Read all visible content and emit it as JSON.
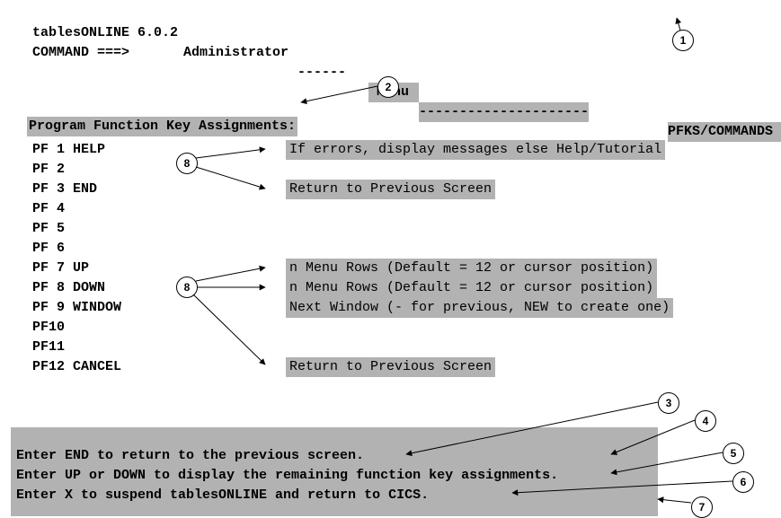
{
  "header": {
    "brand": "tablesONLINE 6.0.2",
    "role": "Administrator",
    "dashes1": "------",
    "menu": " Menu ",
    "dashes2": "---------------------",
    "right_label": "PFKS/COMMANDS"
  },
  "command": {
    "label": "COMMAND ===>"
  },
  "subtitle": "Program Function Key Assignments:",
  "pf_rows": [
    {
      "label": "PF 1 HELP",
      "desc": "If errors, display messages else Help/Tutorial"
    },
    {
      "label": "PF 2",
      "desc": ""
    },
    {
      "label": "PF 3 END",
      "desc": "Return to Previous Screen"
    },
    {
      "label": "PF 4",
      "desc": ""
    },
    {
      "label": "PF 5",
      "desc": ""
    },
    {
      "label": "PF 6",
      "desc": ""
    },
    {
      "label": "PF 7 UP",
      "desc": "n Menu Rows (Default = 12 or cursor position)"
    },
    {
      "label": "PF 8 DOWN",
      "desc": "n Menu Rows (Default = 12 or cursor position)"
    },
    {
      "label": "PF 9 WINDOW",
      "desc": "Next Window (- for previous, NEW to create one)"
    },
    {
      "label": "PF10",
      "desc": ""
    },
    {
      "label": "PF11",
      "desc": ""
    },
    {
      "label": "PF12 CANCEL",
      "desc": "Return to Previous Screen"
    }
  ],
  "instructions": [
    "Enter END to return to the previous screen.",
    "Enter UP or DOWN to display the remaining function key assignments.",
    "Enter X to suspend tablesONLINE and return to CICS."
  ],
  "callouts": {
    "c1": "1",
    "c2": "2",
    "c3": "3",
    "c4": "4",
    "c5": "5",
    "c6": "6",
    "c7": "7",
    "c8a": "8",
    "c8b": "8"
  }
}
